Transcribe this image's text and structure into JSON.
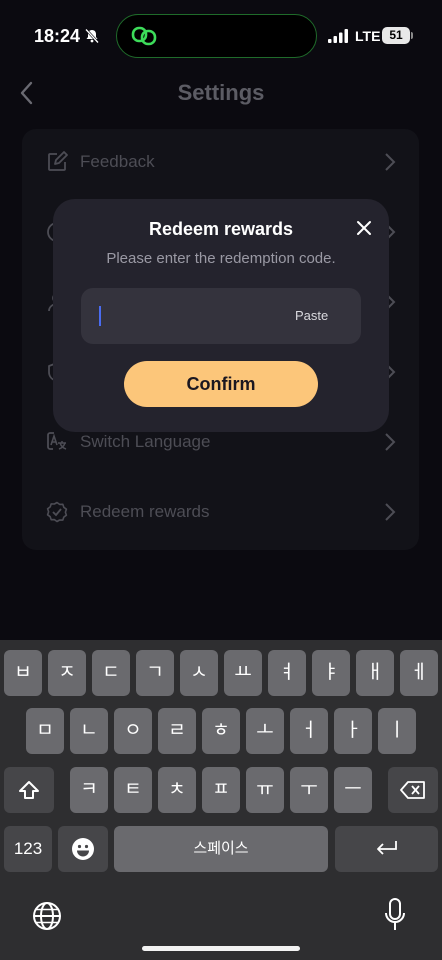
{
  "status_bar": {
    "time": "18:24",
    "network": "LTE",
    "battery": "51"
  },
  "header": {
    "title": "Settings"
  },
  "settings_items": [
    {
      "label": "Feedback",
      "icon": "edit-icon"
    },
    {
      "label": "",
      "icon": "info-icon"
    },
    {
      "label": "",
      "icon": "user-icon"
    },
    {
      "label": "",
      "icon": "shield-icon"
    },
    {
      "label": "Switch Language",
      "icon": "translate-icon"
    },
    {
      "label": "Redeem rewards",
      "icon": "badge-check-icon"
    }
  ],
  "dialog": {
    "title": "Redeem rewards",
    "subtitle": "Please enter the redemption code.",
    "input_value": "",
    "paste_label": "Paste",
    "confirm_label": "Confirm"
  },
  "keyboard": {
    "row1": [
      "ㅂ",
      "ㅈ",
      "ㄷ",
      "ㄱ",
      "ㅅ",
      "ㅛ",
      "ㅕ",
      "ㅑ",
      "ㅐ",
      "ㅔ"
    ],
    "row2": [
      "ㅁ",
      "ㄴ",
      "ㅇ",
      "ㄹ",
      "ㅎ",
      "ㅗ",
      "ㅓ",
      "ㅏ",
      "ㅣ"
    ],
    "row3": [
      "ㅋ",
      "ㅌ",
      "ㅊ",
      "ㅍ",
      "ㅠ",
      "ㅜ",
      "ㅡ"
    ],
    "numbers_label": "123",
    "space_label": "스페이스"
  },
  "colors": {
    "background": "#0b0a10",
    "card": "#121218",
    "dialog": "#24232d",
    "accent": "#fcc67a",
    "caret": "#4a6cf0"
  }
}
